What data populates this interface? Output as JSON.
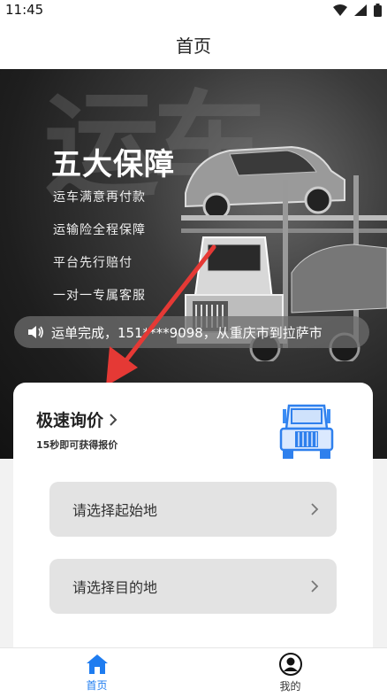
{
  "status_bar": {
    "time": "11:45"
  },
  "header": {
    "title": "首页"
  },
  "banner": {
    "title": "五大保障",
    "background_text": "运车",
    "perks": [
      "运车满意再付款",
      "运输险全程保障",
      "平台先行赔付",
      "一对一专属客服"
    ],
    "ticker_text": "运单完成，151****9098，从重庆市到拉萨市"
  },
  "quote_card": {
    "title": "极速询价",
    "subtitle": "15秒即可获得报价",
    "origin_placeholder": "请选择起始地",
    "destination_placeholder": "请选择目的地"
  },
  "bottom_nav": {
    "home_label": "首页",
    "mine_label": "我的"
  },
  "colors": {
    "accent": "#1e7cf0",
    "arrow": "#e53935"
  }
}
